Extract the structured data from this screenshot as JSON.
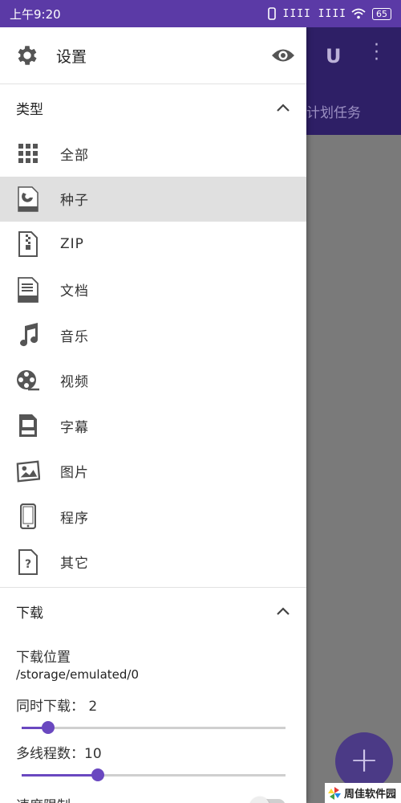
{
  "status_bar": {
    "time": "上午9:20",
    "signal": "IIII IIII",
    "battery": "65"
  },
  "background_app": {
    "tab_label": "计划任务"
  },
  "drawer": {
    "header": {
      "title": "设置"
    },
    "types_section": {
      "title": "类型",
      "items": [
        {
          "label": "全部",
          "icon": "grid-icon"
        },
        {
          "label": "种子",
          "icon": "torrent-icon",
          "selected": true
        },
        {
          "label": "ZIP",
          "icon": "zip-icon"
        },
        {
          "label": "文档",
          "icon": "doc-icon"
        },
        {
          "label": "音乐",
          "icon": "music-icon"
        },
        {
          "label": "视频",
          "icon": "film-icon"
        },
        {
          "label": "字幕",
          "icon": "subtitle-icon"
        },
        {
          "label": "图片",
          "icon": "image-icon"
        },
        {
          "label": "程序",
          "icon": "phone-icon"
        },
        {
          "label": "其它",
          "icon": "unknown-file-icon"
        }
      ]
    },
    "download_section": {
      "title": "下载",
      "location_label": "下载位置",
      "location_value": "/storage/emulated/0",
      "simultaneous_label": "同时下载： 2",
      "simultaneous_fraction": 0.1,
      "threads_label": "多线程数：10",
      "threads_fraction": 0.29,
      "speed_limit_label": "速度限制",
      "speed_limit_enabled": false
    }
  },
  "watermark": {
    "text": "周佳软件园"
  },
  "colors": {
    "accent": "#6a48c0",
    "status_bar": "#5b3aa6",
    "app_bar_dark": "#2e1f66",
    "selected_row": "#e0e0e0"
  }
}
